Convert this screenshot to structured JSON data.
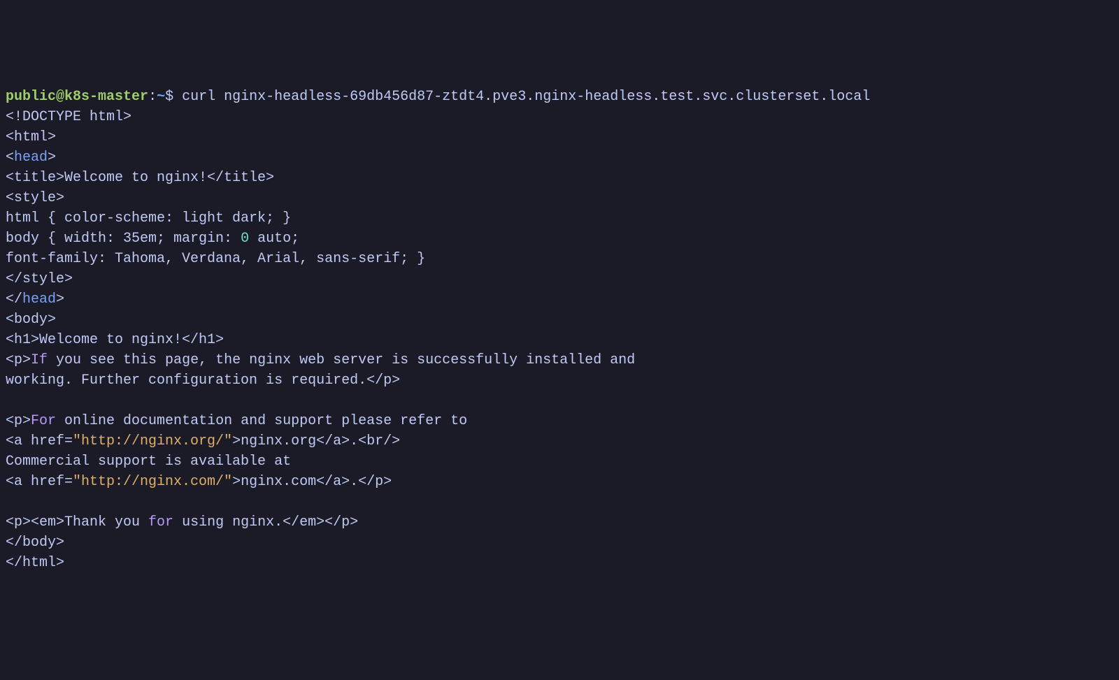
{
  "prompt": {
    "user": "public",
    "at": "@",
    "host": "k8s-master",
    "colon": ":",
    "path": "~",
    "dollar": "$ ",
    "command": "curl nginx-headless-69db456d87-ztdt4.pve3.nginx-headless.test.svc.clusterset.local"
  },
  "output": {
    "l01": "<!DOCTYPE html>",
    "l02": "<html>",
    "l03a": "<",
    "l03b": "head",
    "l03c": ">",
    "l04": "<title>Welcome to nginx!</title>",
    "l05": "<style>",
    "l06": "html { color-scheme: light dark; }",
    "l07a": "body { width: 35em; margin: ",
    "l07b": "0",
    "l07c": " auto;",
    "l08": "font-family: Tahoma, Verdana, Arial, sans-serif; }",
    "l09": "</style>",
    "l10a": "</",
    "l10b": "head",
    "l10c": ">",
    "l11": "<body>",
    "l12": "<h1>Welcome to nginx!</h1>",
    "l13a": "<p>",
    "l13b": "If",
    "l13c": " you see this page, the nginx web server is successfully installed and",
    "l14": "working. Further configuration is required.</p>",
    "l15": "",
    "l16a": "<p>",
    "l16b": "For",
    "l16c": " online documentation and support please refer to",
    "l17a": "<a href=",
    "l17b": "\"http://nginx.org/\"",
    "l17c": ">nginx.org</a>.<br/>",
    "l18": "Commercial support is available at",
    "l19a": "<a href=",
    "l19b": "\"http://nginx.com/\"",
    "l19c": ">nginx.com</a>.</p>",
    "l20": "",
    "l21a": "<p><em>Thank you ",
    "l21b": "for",
    "l21c": " using nginx.</em></p>",
    "l22": "</body>",
    "l23": "</html>"
  }
}
